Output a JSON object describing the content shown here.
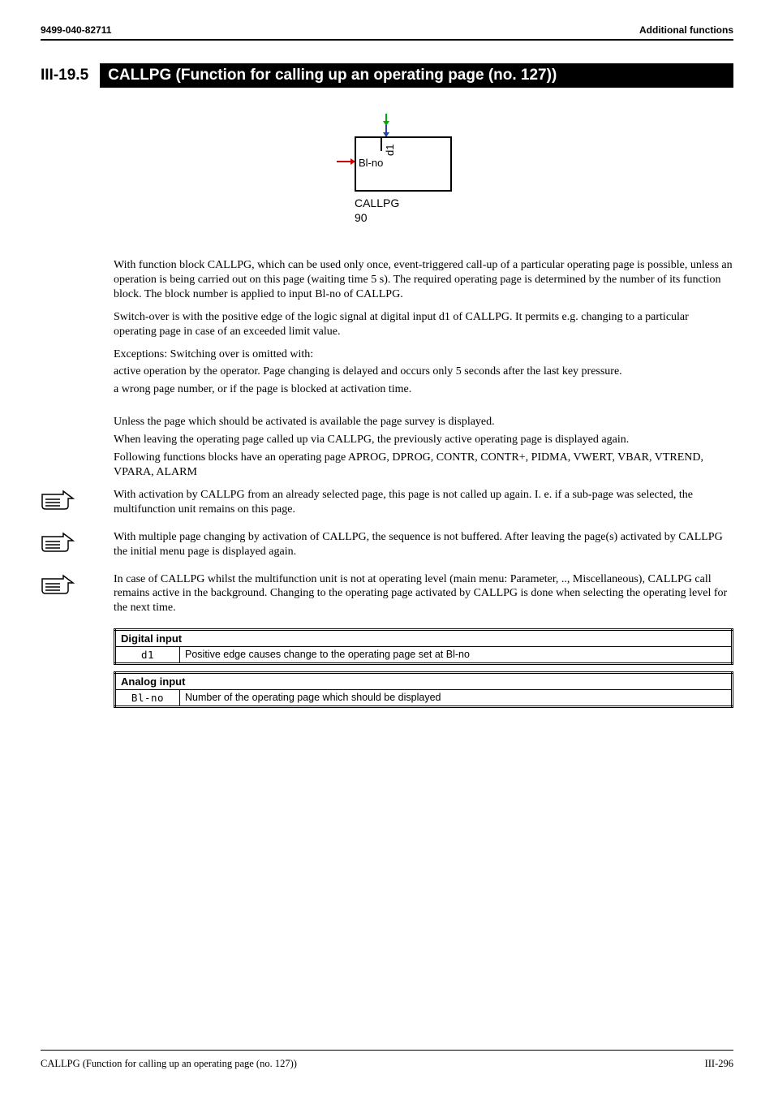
{
  "header": {
    "left": "9499-040-82711",
    "right": "Additional functions"
  },
  "section": {
    "num": "III-19.5",
    "title": "CALLPG (Function for calling up an operating page (no. 127))"
  },
  "diagram": {
    "bino": "Bl-no",
    "d1": "d1",
    "callpg": "CALLPG",
    "ninety": "90"
  },
  "paras": {
    "p1": "With function block CALLPG, which can be used only once, event-triggered call-up of a particular operating page is possible, unless an operation is being carried out on this page (waiting time 5 s). The required operating page is determined by the number of its function block. The block number is applied to input  Bl-no of CALLPG.",
    "p2": "Switch-over is with the positive edge of the logic signal at digital input d1 of CALLPG. It permits e.g. changing to a particular operating page in case of an exceeded limit value.",
    "p3": "Exceptions: Switching over is omitted with:",
    "p4": "active operation by the operator. Page changing is delayed and occurs only 5 seconds after the last key pressure.",
    "p5": "a wrong page number, or if the page is blocked at activation time.",
    "p6": "Unless the page which should be activated is available the page survey is displayed.",
    "p7": "When leaving the operating page called up via CALLPG, the previously active operating page is displayed again.",
    "p8": "Following functions blocks have an operating page APROG, DPROG, CONTR, CONTR+, PIDMA, VWERT, VBAR, VTREND, VPARA, ALARM",
    "note1": "With activation by CALLPG from an already selected page, this page is not called up again. I. e. if a sub-page was selected, the multifunction unit remains on this page.",
    "note2": "With multiple page changing by activation of CALLPG, the sequence is not buffered. After leaving the page(s) activated by CALLPG the initial menu page is displayed again.",
    "note3": "In case of  CALLPG whilst the multifunction unit is not at operating level (main menu:  Parameter, .., Miscellaneous), CALLPG call remains active in the background. Changing to the operating page activated by CALLPG is done when selecting the operating level for the next time."
  },
  "tables": {
    "digital": {
      "header": "Digital input",
      "key": "d1",
      "desc": "Positive edge causes change to the operating page set at Bl-no"
    },
    "analog": {
      "header": "Analog input",
      "key": "Bl-no",
      "desc": "Number of the operating page which should be displayed"
    }
  },
  "footer": {
    "left": "CALLPG (Function for calling up an operating page (no. 127))",
    "right": "III-296"
  }
}
